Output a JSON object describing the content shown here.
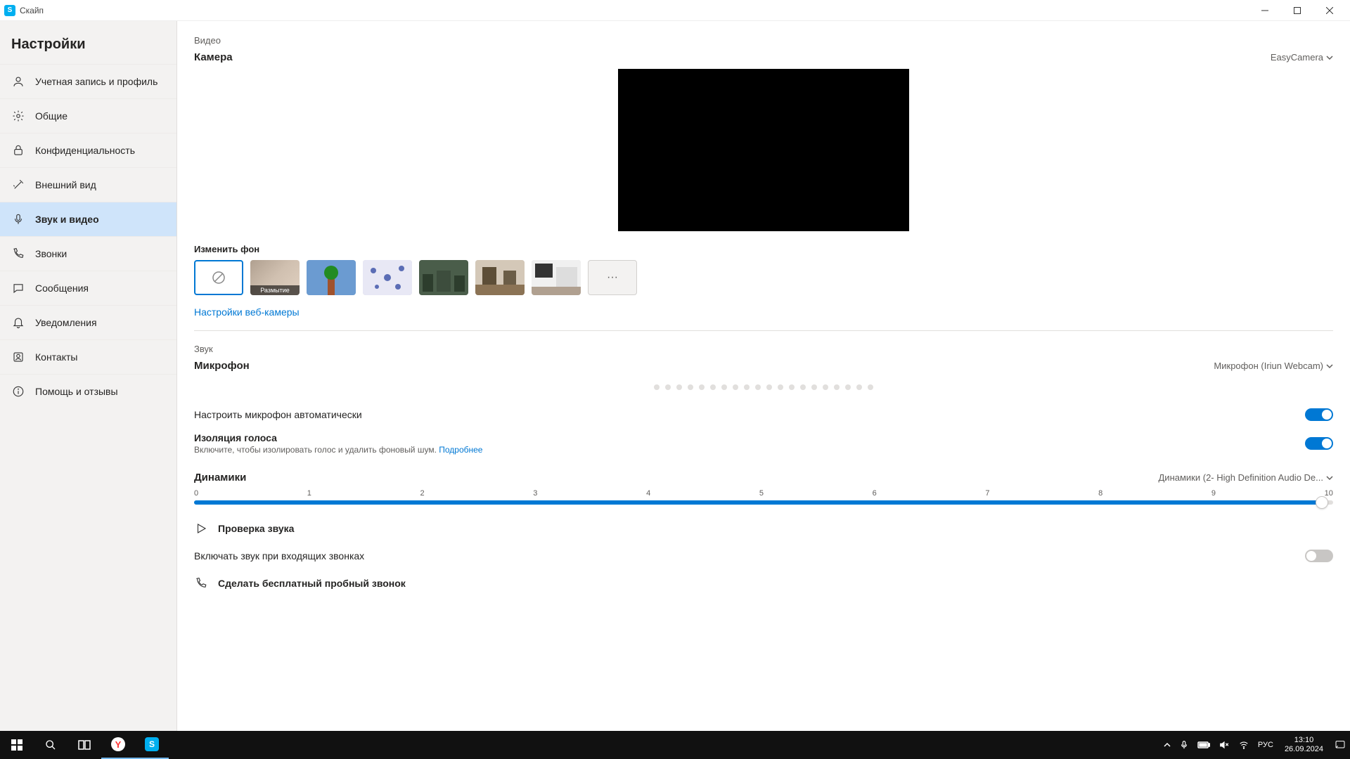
{
  "app_title": "Скайп",
  "sidebar": {
    "title": "Настройки",
    "items": [
      {
        "label": "Учетная запись и профиль"
      },
      {
        "label": "Общие"
      },
      {
        "label": "Конфиденциальность"
      },
      {
        "label": "Внешний вид"
      },
      {
        "label": "Звук и видео"
      },
      {
        "label": "Звонки"
      },
      {
        "label": "Сообщения"
      },
      {
        "label": "Уведомления"
      },
      {
        "label": "Контакты"
      },
      {
        "label": "Помощь и отзывы"
      }
    ]
  },
  "video": {
    "section": "Видео",
    "camera_title": "Камера",
    "camera_device": "EasyCamera",
    "change_bg": "Изменить фон",
    "blur_label": "Размытие",
    "webcam_link": "Настройки веб-камеры"
  },
  "audio": {
    "section": "Звук",
    "mic_title": "Микрофон",
    "mic_device": "Микрофон (Iriun Webcam)",
    "auto_mic": "Настроить микрофон автоматически",
    "voice_iso_title": "Изоляция голоса",
    "voice_iso_sub": "Включите, чтобы изолировать голос и удалить фоновый шум.",
    "voice_iso_link": "Подробнее",
    "speakers_title": "Динамики",
    "speakers_device": "Динамики (2- High Definition Audio De...",
    "slider_ticks": [
      "0",
      "1",
      "2",
      "3",
      "4",
      "5",
      "6",
      "7",
      "8",
      "9",
      "10"
    ],
    "slider_value": 10,
    "test_audio": "Проверка звука",
    "ring_incoming": "Включать звук при входящих звонках",
    "test_call": "Сделать бесплатный пробный звонок"
  },
  "taskbar": {
    "lang": "РУС",
    "time": "13:10",
    "date": "26.09.2024"
  }
}
